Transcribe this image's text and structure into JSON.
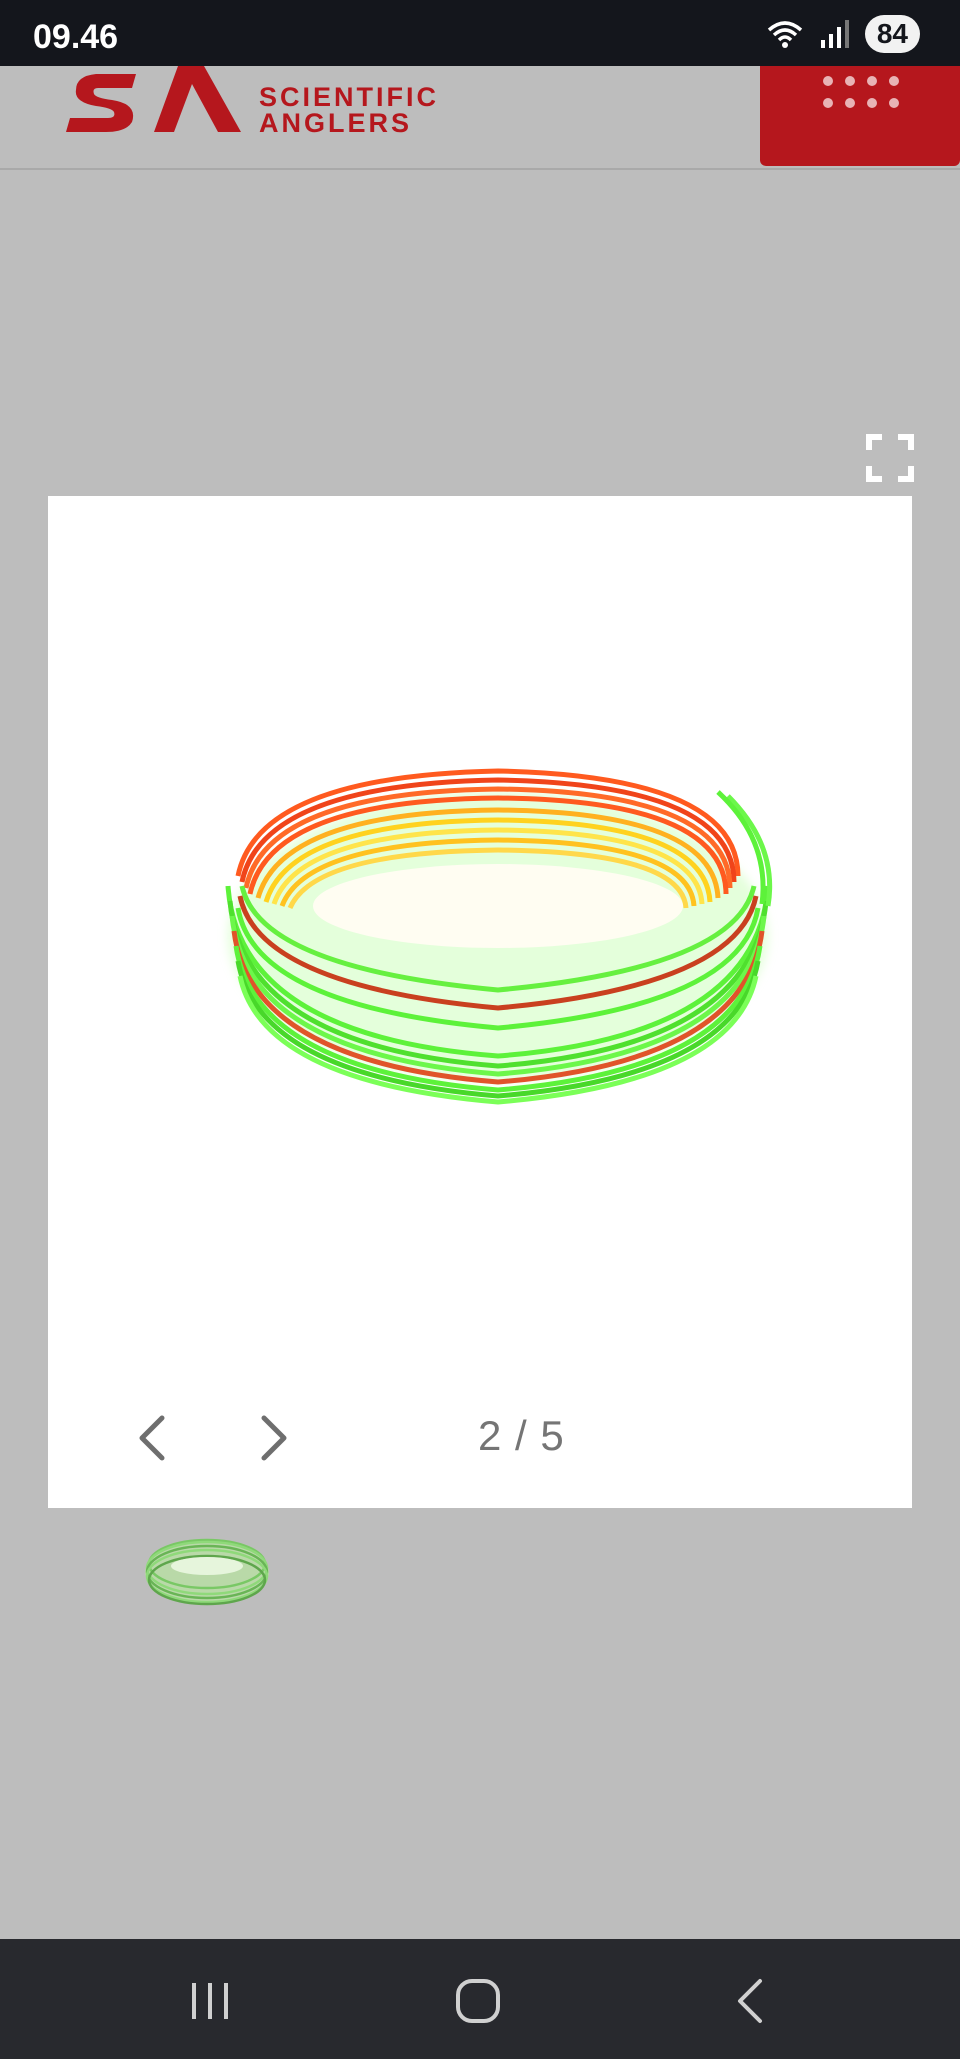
{
  "status_bar": {
    "time": "09.46",
    "battery": "84",
    "icons": [
      "wifi-icon",
      "signal-icon",
      "battery-icon"
    ]
  },
  "header": {
    "logo_line1": "SCIENTIFIC",
    "logo_line2": "ANGLERS",
    "brand_color": "#b5171d",
    "menu_icon": "grid-dots-icon"
  },
  "gallery": {
    "counter": "2 / 5",
    "current_index": 2,
    "total": 5,
    "prev_icon": "chevron-left-icon",
    "next_icon": "chevron-right-icon",
    "fullscreen_icon": "fullscreen-icon",
    "product_image": "fly-line-coil-image",
    "line_colors": [
      "#ff5a1f",
      "#ffd21f",
      "#5df23a"
    ]
  },
  "system_nav": {
    "icons": [
      "recents-icon",
      "home-icon",
      "back-icon"
    ]
  }
}
